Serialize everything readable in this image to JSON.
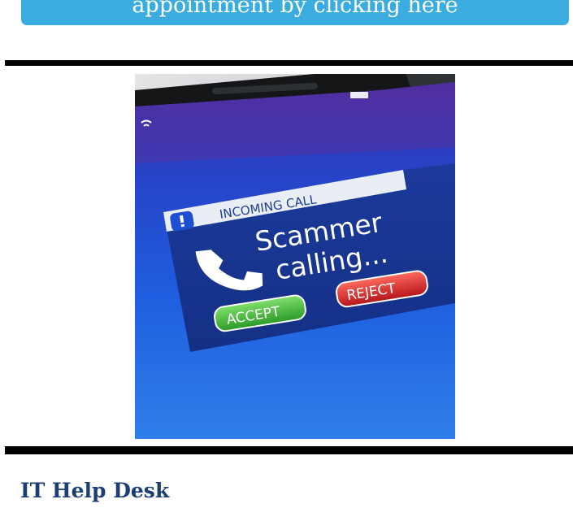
{
  "cta": {
    "label": "appointment by clicking here"
  },
  "hero": {
    "banner_text": "INCOMING CALL",
    "caller_line1": "Scammer",
    "caller_line2": "calling...",
    "accept_label": "ACCEPT",
    "reject_label": "REJECT",
    "icons": {
      "alert": "alert-icon",
      "phone": "phone-handset-icon"
    }
  },
  "section": {
    "heading": "IT Help Desk"
  },
  "colors": {
    "cta_background": "#3aace0",
    "heading": "#1b3f75",
    "divider": "#000000",
    "accept": "#3fb53a",
    "reject": "#d8262b",
    "banner": "#e9eef5",
    "screen": "#1f59d9"
  }
}
